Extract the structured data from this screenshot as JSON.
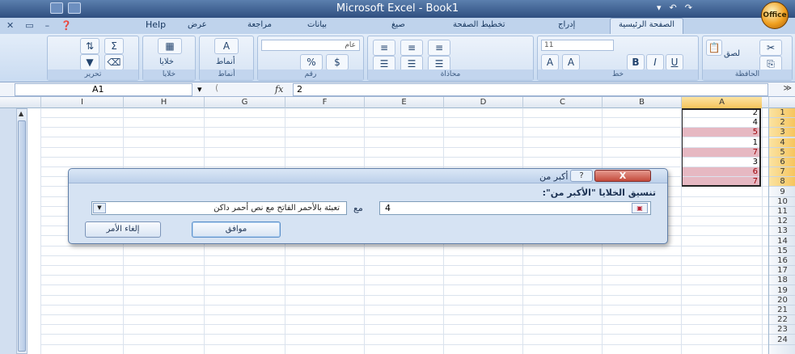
{
  "window": {
    "title": "Microsoft Excel - Book1",
    "office_button": "Office"
  },
  "tabs": {
    "help": "Help",
    "items": [
      "الصفحة الرئيسية",
      "إدراج",
      "تخطيط الصفحة",
      "صيغ",
      "بيانات",
      "مراجعة",
      "عرض"
    ]
  },
  "ribbon": {
    "groups": [
      "الحافظة",
      "خط",
      "محاذاة",
      "رقم",
      "أنماط",
      "خلايا",
      "تحرير"
    ],
    "paste_label": "لصق",
    "styles_label": "أنماط",
    "cells_label": "خلايا",
    "font_size": "11",
    "number_format": "عام",
    "bold": "B",
    "italic": "I",
    "underline": "U",
    "percent": "%",
    "currency": "$",
    "sigma": "Σ"
  },
  "formula_bar": {
    "name_box": "A1",
    "fx": "fx",
    "value": "2"
  },
  "grid": {
    "columns": [
      "I",
      "H",
      "G",
      "F",
      "E",
      "D",
      "C",
      "B",
      "A"
    ],
    "rows": [
      "1",
      "2",
      "3",
      "4",
      "5",
      "6",
      "7",
      "8",
      "9",
      "10",
      "11",
      "12",
      "13",
      "14",
      "15",
      "16",
      "17",
      "18",
      "19",
      "20",
      "21",
      "22",
      "23",
      "24"
    ],
    "column_a_values": [
      "2",
      "4",
      "5",
      "1",
      "7",
      "3",
      "6",
      "7"
    ],
    "highlighted_rows": [
      3,
      5,
      7,
      8
    ]
  },
  "dialog": {
    "title": "أكبر من",
    "help": "?",
    "close": "X",
    "prompt": "تنسيق الخلايا \"الأكبر من\":",
    "input_value": "4",
    "with_label": "مع",
    "format_option": "تعبئة بالأحمر الفاتح مع نص أحمر داكن",
    "ok": "موافق",
    "cancel": "إلغاء الأمر"
  },
  "colors": {
    "highlight_fill": "#e6b8c2",
    "highlight_text": "#9c0006",
    "selection_header": "#f6c45c"
  }
}
